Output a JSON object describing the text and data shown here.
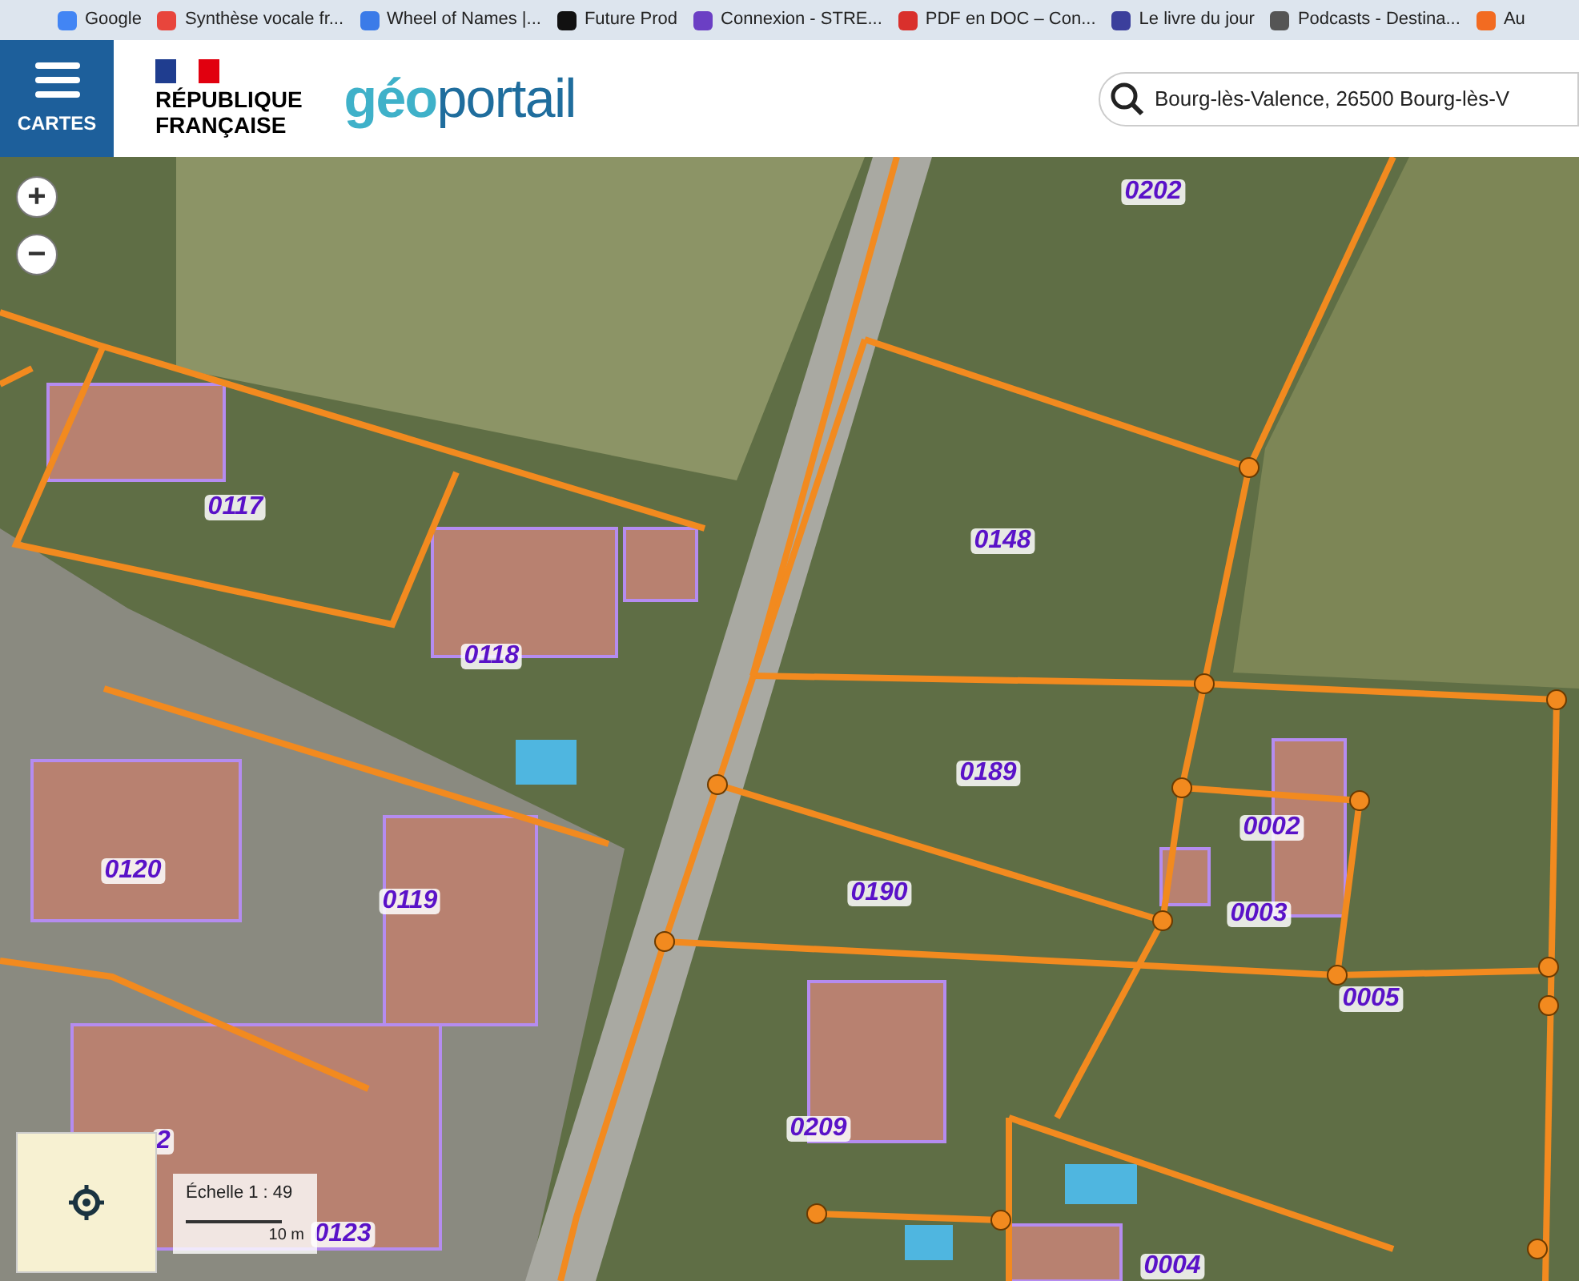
{
  "bookmarks": [
    {
      "label": "Google",
      "color": "#4285f4"
    },
    {
      "label": "Synthèse vocale fr...",
      "color": "#e8453c"
    },
    {
      "label": "Wheel of Names |...",
      "color": "#3b7be8"
    },
    {
      "label": "Future Prod",
      "color": "#111111"
    },
    {
      "label": "Connexion - STRE...",
      "color": "#6b3fc4"
    },
    {
      "label": "PDF en DOC – Con...",
      "color": "#d9302c"
    },
    {
      "label": "Le livre du jour",
      "color": "#3b3f9c"
    },
    {
      "label": "Podcasts - Destina...",
      "color": "#555555"
    },
    {
      "label": "Au",
      "color": "#f26b21"
    }
  ],
  "menu_button": {
    "label": "CARTES"
  },
  "brand": {
    "line_1": "RÉPUBLIQUE",
    "line_2": "FRANÇAISE"
  },
  "logo": {
    "part_1": "géo",
    "part_2": "portail"
  },
  "search": {
    "value": "Bourg-lès-Valence, 26500 Bourg-lès-V"
  },
  "zoom_controls": [
    "+",
    "−"
  ],
  "parcels": [
    "0202",
    "0117",
    "0148",
    "0118",
    "0189",
    "0120",
    "0119",
    "0190",
    "0002",
    "0003",
    "0005",
    "0209",
    "0004",
    "0123",
    "2"
  ],
  "scale": {
    "label": "Échelle 1 : 49",
    "distance": "10 m"
  }
}
